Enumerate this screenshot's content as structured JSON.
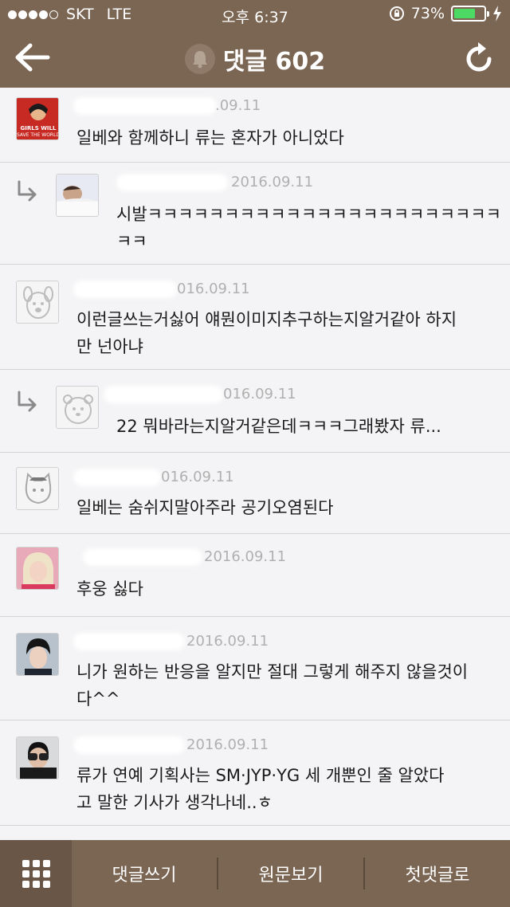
{
  "status": {
    "carrier": "SKT",
    "network": "LTE",
    "time": "오후 6:37",
    "battery": "73%",
    "battery_level": 0.73
  },
  "nav": {
    "title": "댓글 602"
  },
  "comments": [
    {
      "author": "",
      "date": ".09.11",
      "text": "일베와 함께하니 류는 혼자가 아니었다",
      "avatar": "wonder-woman"
    },
    {
      "author": "",
      "date": "2016.09.11",
      "text": "시발ㅋㅋㅋㅋㅋㅋㅋㅋㅋㅋㅋㅋㅋㅋㅋㅋㅋㅋㅋㅋㅋㅋㅋ",
      "text2": "ㅋㅋ",
      "avatar": "sleeping-person",
      "reply": true
    },
    {
      "author": "",
      "date": "016.09.11",
      "text": "이런글쓰는거싫어 얘뭔이미지추구하는지알거같아 하지",
      "text2": "만 넌아냐",
      "avatar": "cartoon-dog"
    },
    {
      "author": "",
      "date": "016.09.11",
      "text": "22 뭐바라는지알거같은데ㅋㅋㅋ그래봤자 류...",
      "avatar": "cartoon-bear",
      "reply": true
    },
    {
      "author": "",
      "date": "016.09.11",
      "text": "일베는 숨쉬지말아주라 공기오염된다",
      "avatar": "cartoon-cat"
    },
    {
      "author": "",
      "date": "2016.09.11",
      "text": "후웅 싫다",
      "avatar": "blonde-person"
    },
    {
      "author": "",
      "date": "2016.09.11",
      "text": "니가 원하는 반응을 알지만 절대 그렇게 해주지 않을것이",
      "text2": "다^^",
      "avatar": "dark-haired-person"
    },
    {
      "author": "",
      "date": "2016.09.11",
      "text": "류가 연예 기획사는 SM·JYP·YG 세 개뿐인 줄 알았다",
      "text2": "고 말한 기사가 생각나네..ㅎ",
      "avatar": "person-binoculars"
    }
  ],
  "bottom": {
    "write": "댓글쓰기",
    "original": "원문보기",
    "first": "첫댓글로"
  },
  "colors": {
    "brand": "#7b6553",
    "battery": "#4cd964"
  }
}
